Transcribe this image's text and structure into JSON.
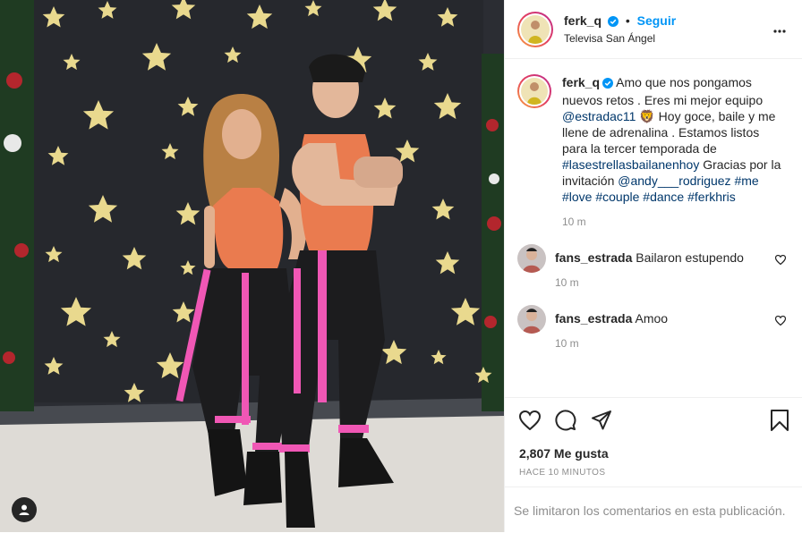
{
  "post": {
    "author": "ferk_q",
    "follow_label": "Seguir",
    "separator": "•",
    "location": "Televisa San Ángel",
    "caption": {
      "text_1": "Amo que nos pongamos nuevos retos . Eres mi mejor equipo ",
      "mention_1": "@estradac11",
      "emoji": "🦁",
      "text_2": " Hoy goce, baile y me llene de adrenalina . Estamos listos para la tercer temporada de ",
      "hashtag_1": "#lasestrellasbailanenhoy",
      "text_3": " Gracias por la invitación ",
      "mention_2": "@andy___rodriguez",
      "tags": "#me #love #couple #dance #ferkhris",
      "time": "10 m"
    },
    "comments": [
      {
        "user": "fans_estrada",
        "text": "Bailaron estupendo",
        "time": "10 m"
      },
      {
        "user": "fans_estrada",
        "text": "Amoo",
        "time": "10 m"
      }
    ],
    "likes": "2,807 Me gusta",
    "posted_ago": "HACE 10 MINUTOS",
    "comments_limited": "Se limitaron los comentarios en esta publicación."
  },
  "icons": {
    "verified": "verified-badge-icon",
    "more": "more-options-icon",
    "like": "heart-icon",
    "comment": "comment-icon",
    "share": "share-icon",
    "save": "bookmark-icon",
    "tag": "user-tag-icon"
  },
  "colors": {
    "follow": "#0095f6",
    "verified": "#0095f6",
    "link": "#00376b",
    "muted": "#8e8e8e",
    "divider": "#efefef"
  }
}
